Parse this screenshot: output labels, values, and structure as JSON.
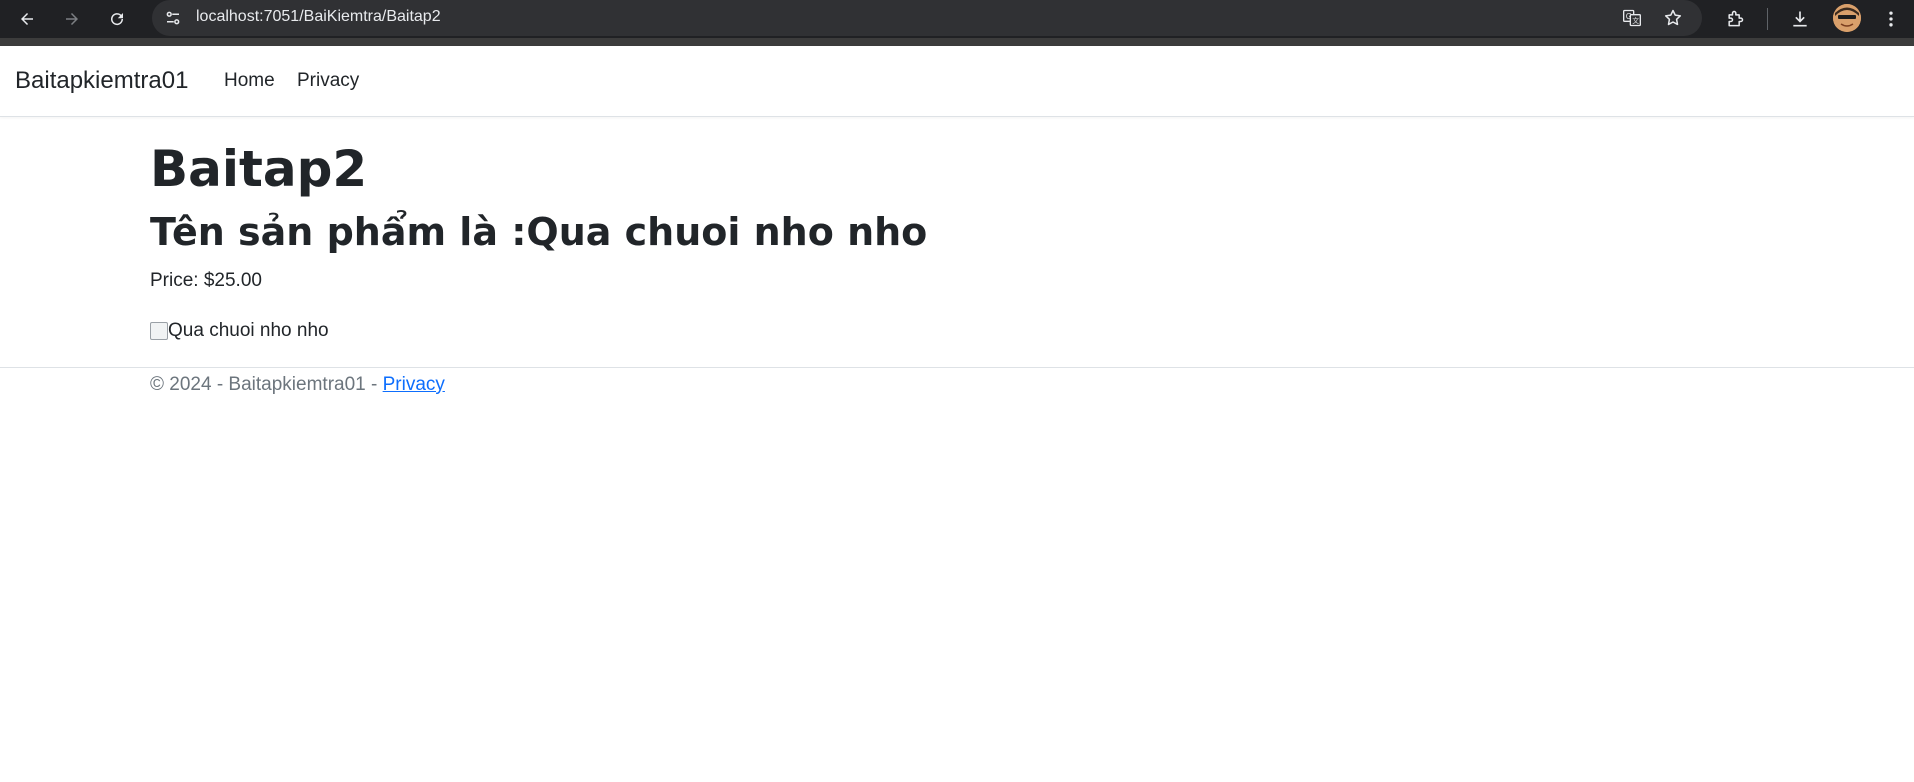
{
  "browser": {
    "url_host": "localhost",
    "url_path": ":7051/BaiKiemtra/Baitap2",
    "icons": [
      "back-icon",
      "forward-icon",
      "reload-icon",
      "site-info-icon",
      "translate-icon",
      "bookmark-star-icon",
      "extensions-icon",
      "download-icon",
      "profile-avatar",
      "menu-kebab-icon"
    ]
  },
  "navbar": {
    "brand": "Baitapkiemtra01",
    "links": [
      "Home",
      "Privacy"
    ]
  },
  "main": {
    "title": "Baitap2",
    "product_heading": "Tên sản phẩm là :Qua chuoi nho nho",
    "price": "Price: $25.00",
    "image_alt": "Qua chuoi nho nho"
  },
  "footer": {
    "text": "© 2024 - Baitapkiemtra01 - ",
    "link": "Privacy"
  },
  "colors": {
    "link_blue": "#0d6efd",
    "text_dark": "#212529",
    "text_muted": "#6c757d",
    "chrome_dark": "#202124"
  }
}
